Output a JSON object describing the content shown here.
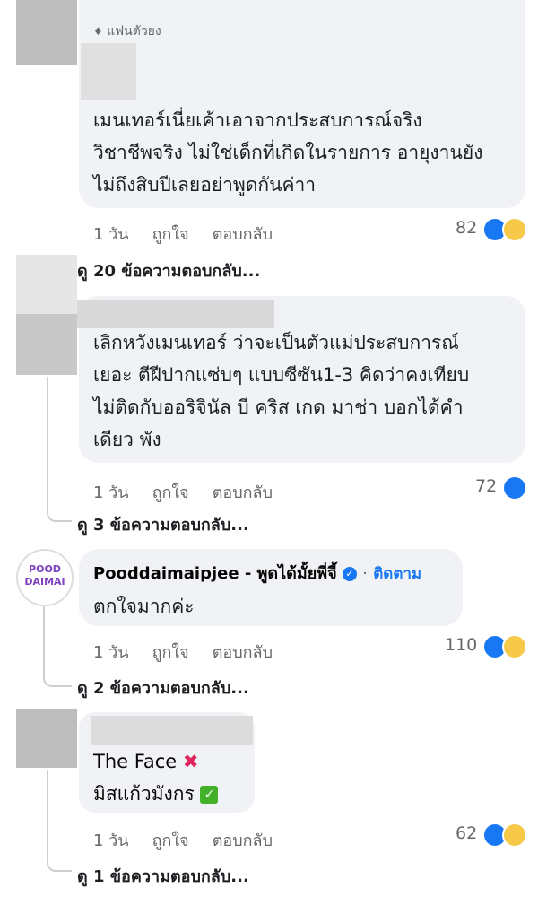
{
  "comments": [
    {
      "badge": "แฟนตัวยง",
      "text": "เมนเทอร์เนี่ยเค้าเอาจากประสบการณ์จริง\nวิชาชีพจริง ไม่ใช่เด็กที่เกิดในรายการ อายุงานยัง\nไม่ถึงสิบปีเลยอย่าพูดกันค่าา",
      "time": "1 วัน",
      "like": "ถูกใจ",
      "reply": "ตอบกลับ",
      "reactions": "82",
      "view_replies": "ดู 20 ข้อความตอบกลับ..."
    },
    {
      "text": "เลิกหวังเมนเทอร์ ว่าจะเป็นตัวแม่ประสบการณ์\nเยอะ ตีฝีปากแซ่บๆ แบบซีซัน1-3 คิดว่าคงเทียบ\nไม่ติดกับออริจินัล บี คริส เกด มาช่า บอกได้คำ\nเดียว พัง",
      "time": "1 วัน",
      "like": "ถูกใจ",
      "reply": "ตอบกลับ",
      "reactions": "72",
      "view_replies": "ดู 3 ข้อความตอบกลับ..."
    },
    {
      "author": "Pooddaimaipjee - พูดได้มั้ยพี่จี้",
      "follow": "ติดตาม",
      "text": "ตกใจมากค่ะ",
      "avatar_text": "POOD DAIMAI",
      "time": "1 วัน",
      "like": "ถูกใจ",
      "reply": "ตอบกลับ",
      "reactions": "110",
      "view_replies": "ดู 2 ข้อความตอบกลับ..."
    },
    {
      "line1": "The Face",
      "line2": "มิสแก้วมังกร",
      "time": "1 วัน",
      "like": "ถูกใจ",
      "reply": "ตอบกลับ",
      "reactions": "62",
      "view_replies": "ดู 1 ข้อความตอบกลับ..."
    }
  ],
  "colors": {
    "like_blue": "#1877f2",
    "verified": "#1877f2",
    "bubble": "#f0f2f5"
  }
}
